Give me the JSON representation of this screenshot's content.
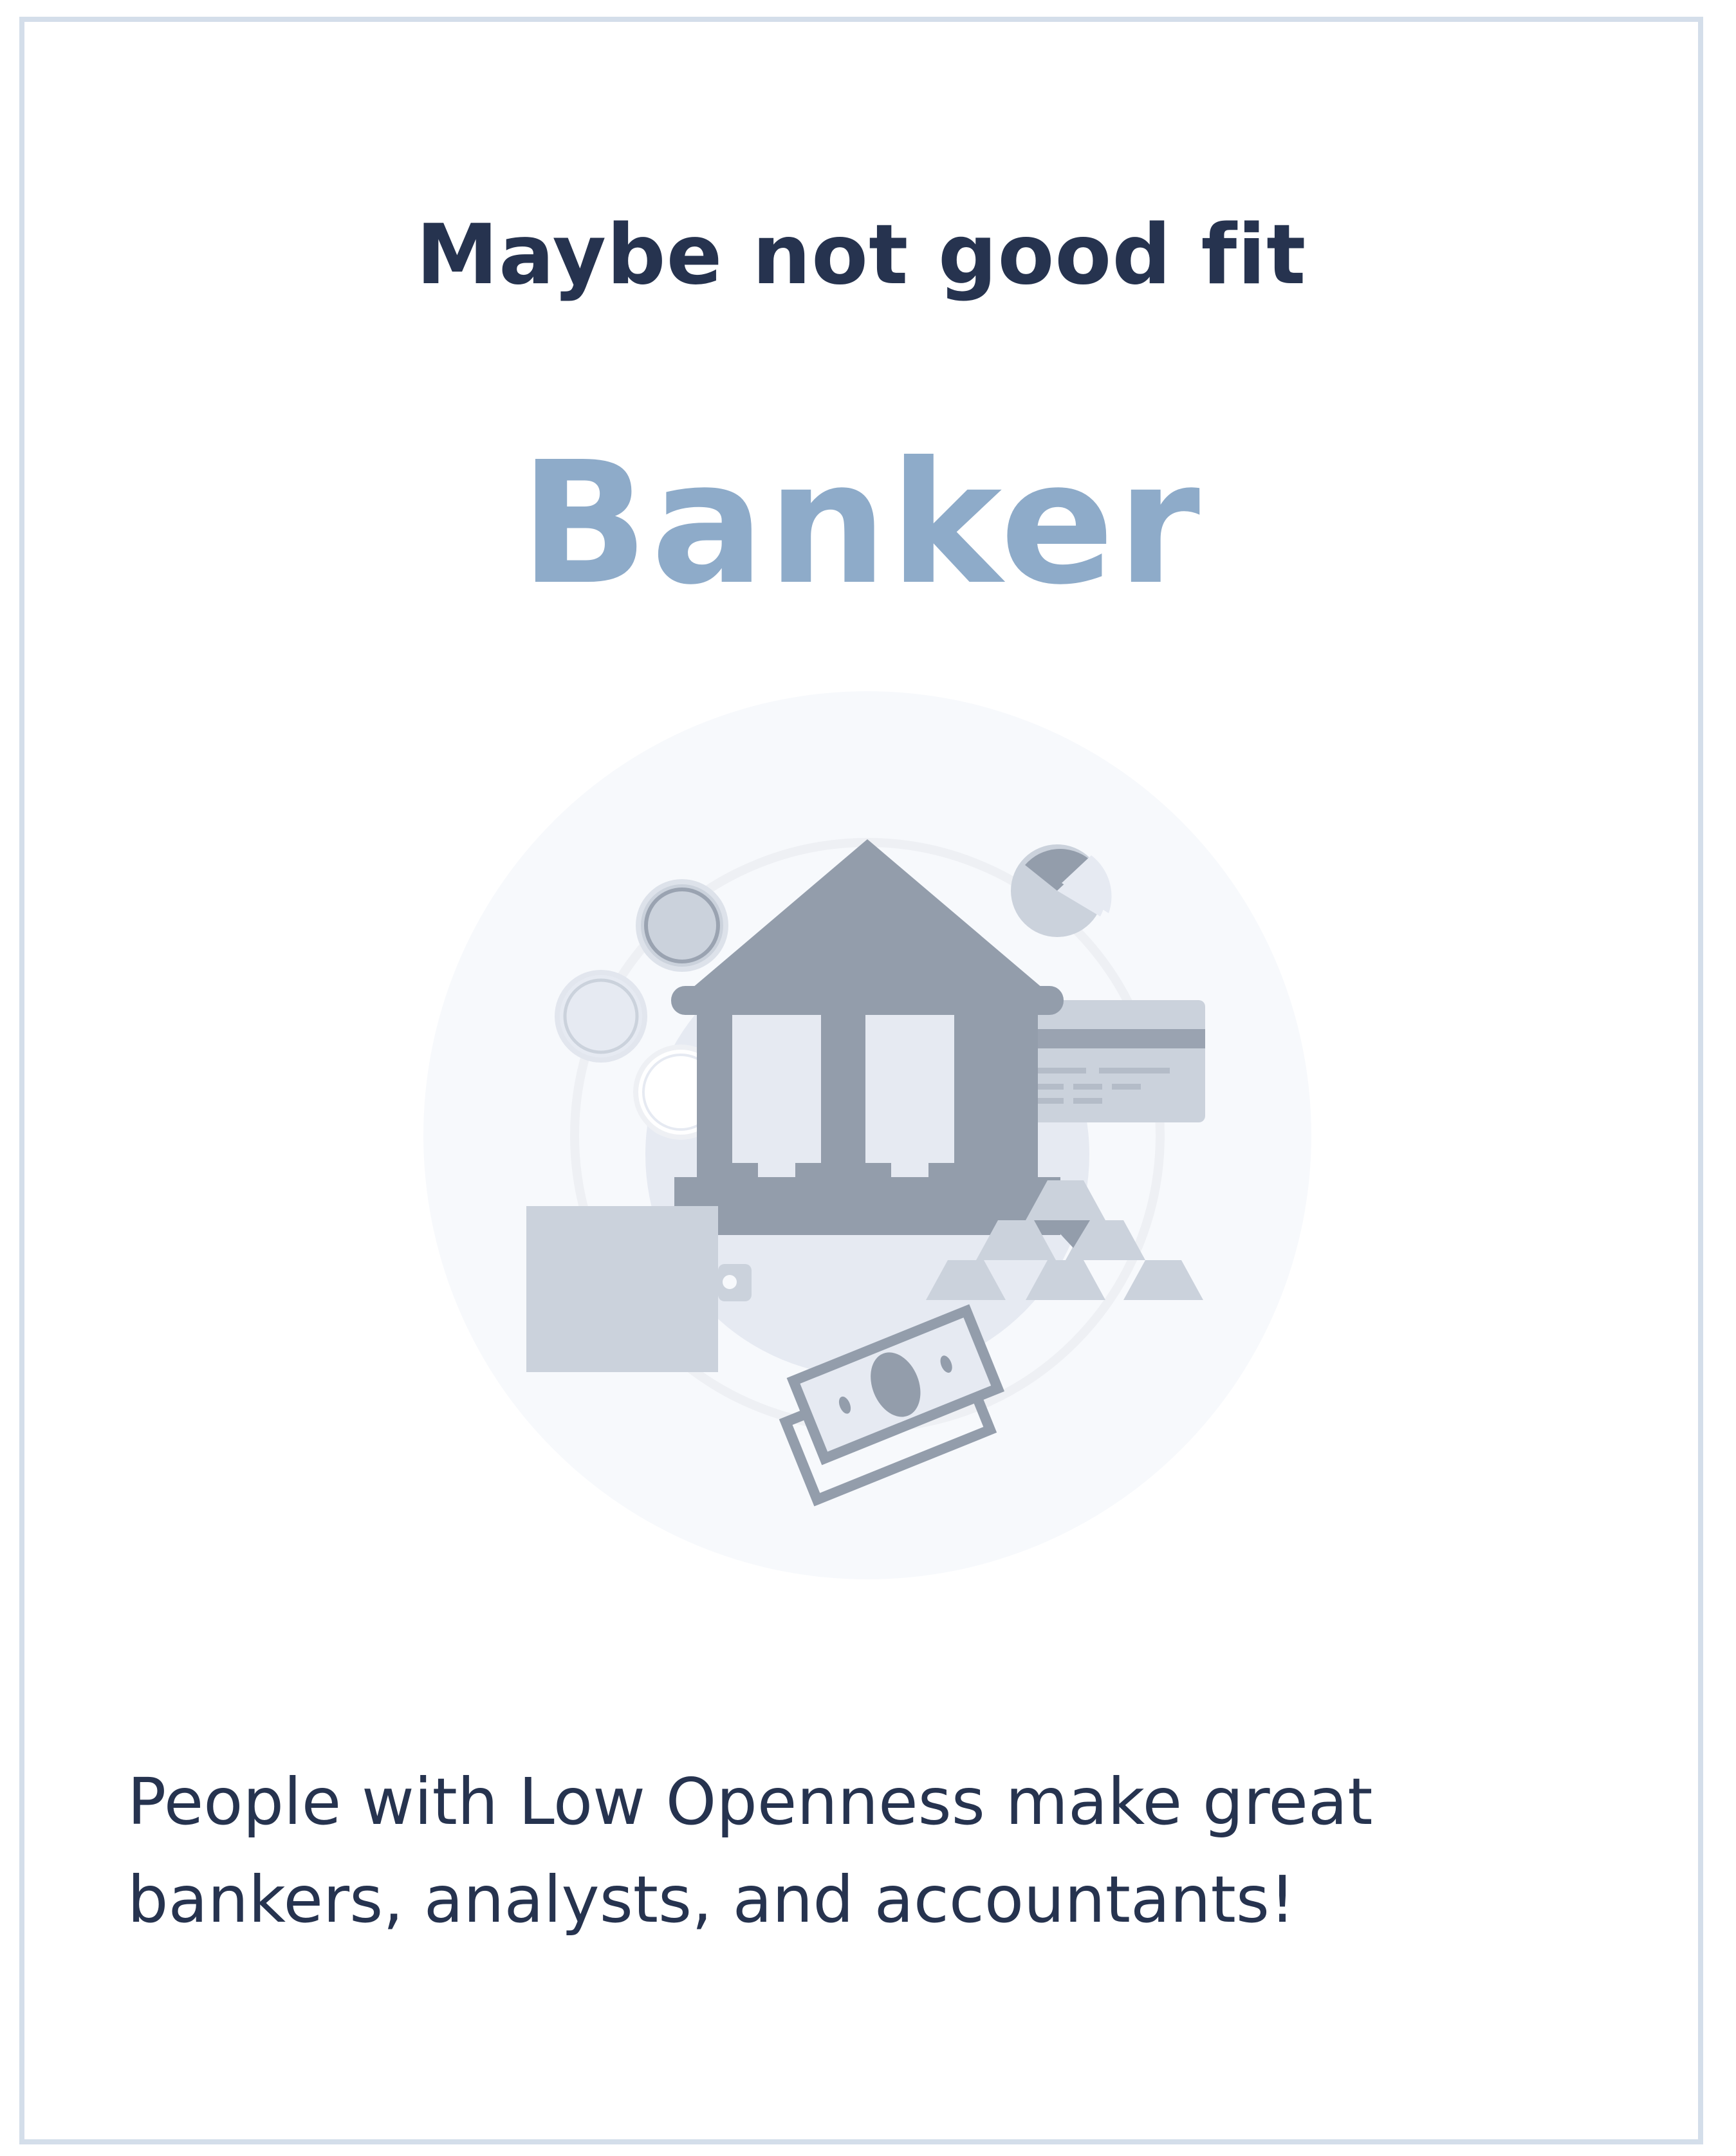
{
  "card": {
    "subtitle": "Maybe not good fit",
    "title": "Banker",
    "illustration_icon": "bank-finance-icon",
    "description": "People with Low Openness make great bankers, analysts, and accountants!"
  },
  "colors": {
    "subtitle": "#26334f",
    "title": "#8eabc9",
    "border": "#d4deea",
    "illustration_dark": "#939dab",
    "illustration_light": "#cbd2dc"
  }
}
